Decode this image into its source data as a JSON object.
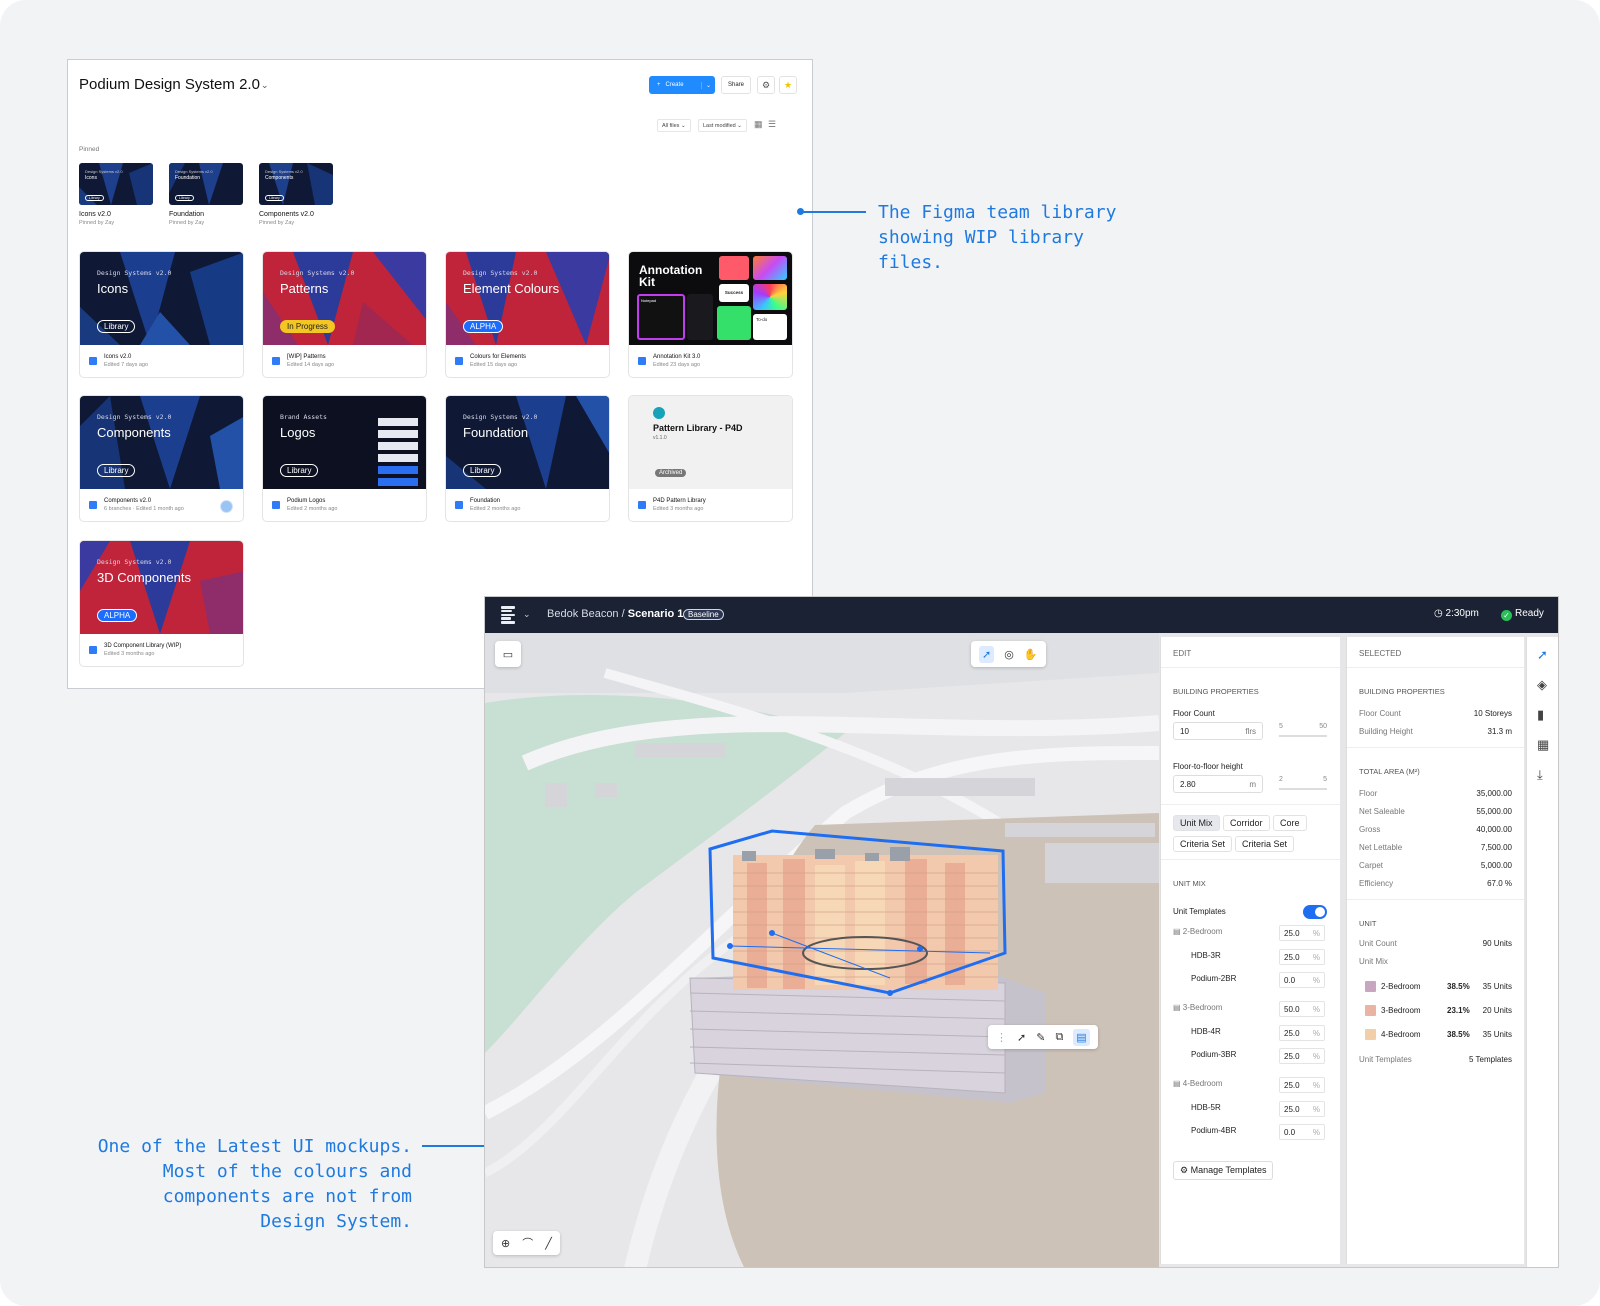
{
  "annotations": {
    "figma_note": [
      "The Figma team library",
      "showing WIP library",
      "files."
    ],
    "ui_note": [
      "One of the Latest UI mockups.",
      "Most of the colours and",
      "components are not from",
      "Design System."
    ]
  },
  "figma": {
    "title": "Podium Design System 2.0",
    "create_label": "Create",
    "share_label": "Share",
    "filter_files": "All files",
    "filter_sort": "Last modified",
    "pinned_label": "Pinned",
    "pinned": [
      {
        "thumb_kicker": "Design Systems v2.0",
        "thumb_title": "Icons",
        "tag": "Library",
        "name": "Icons v2.0",
        "sub": "Pinned by Zay"
      },
      {
        "thumb_kicker": "Design Systems v2.0",
        "thumb_title": "Foundation",
        "tag": "Library",
        "name": "Foundation",
        "sub": "Pinned by Zay"
      },
      {
        "thumb_kicker": "Design Systems v2.0",
        "thumb_title": "Components",
        "tag": "Library",
        "name": "Components v2.0",
        "sub": "Pinned by Zay"
      }
    ],
    "cards": [
      {
        "kicker": "Design Systems v2.0",
        "title": "Icons",
        "tag": "Library",
        "file": "Icons v2.0",
        "meta": "Edited 7 days ago"
      },
      {
        "kicker": "Design Systems v2.0",
        "title": "Patterns",
        "tag": "In Progress",
        "file": "[WIP] Patterns",
        "meta": "Edited 14 days ago"
      },
      {
        "kicker": "Design Systems v2.0",
        "title": "Element Colours",
        "tag": "ALPHA",
        "file": "Colours for Elements",
        "meta": "Edited 15 days ago"
      },
      {
        "title": "Annotation Kit",
        "file": "Annotation Kit 3.0",
        "meta": "Edited 23 days ago",
        "inner_labels": [
          "Notepad",
          "Success",
          "To-do"
        ]
      },
      {
        "kicker": "Design Systems v2.0",
        "title": "Components",
        "tag": "Library",
        "file": "Components v2.0",
        "meta": "6 branches · Edited 1 month ago"
      },
      {
        "kicker": "Brand Assets",
        "title": "Logos",
        "tag": "Library",
        "file": "Podium Logos",
        "meta": "Edited 2 months ago"
      },
      {
        "kicker": "Design Systems v2.0",
        "title": "Foundation",
        "tag": "Library",
        "file": "Foundation",
        "meta": "Edited 2 months ago"
      },
      {
        "title": "Pattern Library - P4D",
        "version": "v1.1.0",
        "tag": "Archived",
        "file": "P4D Pattern Library",
        "meta": "Edited 3 months ago"
      },
      {
        "kicker": "Design Systems v2.0",
        "title": "3D Components",
        "tag": "ALPHA",
        "file": "3D Component Library (WIP)",
        "meta": "Edited 3 months ago"
      }
    ]
  },
  "app": {
    "project": "Bedok Beacon",
    "separator": "/",
    "scenario": "Scenario 1",
    "badge": "Baseline",
    "time": "2:30pm",
    "status": "Ready",
    "edit": {
      "header": "EDIT",
      "section_building": "BUILDING PROPERTIES",
      "floor_count_label": "Floor Count",
      "floor_count_value": "10",
      "floor_count_unit": "flrs",
      "floor_min": "5",
      "floor_max": "50",
      "f2f_label": "Floor-to-floor height",
      "f2f_value": "2.80",
      "f2f_unit": "m",
      "f2f_min": "2",
      "f2f_max": "5",
      "chips": [
        "Unit Mix",
        "Corridor",
        "Core",
        "Criteria Set",
        "Criteria Set"
      ],
      "section_unitmix": "UNIT MIX",
      "unit_templates_label": "Unit Templates",
      "pct_unit": "%",
      "groups": [
        {
          "name": "2-Bedroom",
          "value": "25.0",
          "rows": [
            {
              "name": "HDB-3R",
              "value": "25.0"
            },
            {
              "name": "Podium-2BR",
              "value": "0.0"
            }
          ]
        },
        {
          "name": "3-Bedroom",
          "value": "50.0",
          "rows": [
            {
              "name": "HDB-4R",
              "value": "25.0"
            },
            {
              "name": "Podium-3BR",
              "value": "25.0"
            }
          ]
        },
        {
          "name": "4-Bedroom",
          "value": "25.0",
          "rows": [
            {
              "name": "HDB-5R",
              "value": "25.0"
            },
            {
              "name": "Podium-4BR",
              "value": "0.0"
            }
          ]
        }
      ],
      "manage_label": "Manage Templates"
    },
    "selected": {
      "header": "SELECTED",
      "section_building": "BUILDING PROPERTIES",
      "building": [
        {
          "label": "Floor Count",
          "value": "10 Storeys"
        },
        {
          "label": "Building Height",
          "value": "31.3 m"
        }
      ],
      "section_area": "TOTAL AREA (M²)",
      "area": [
        {
          "label": "Floor",
          "value": "35,000.00"
        },
        {
          "label": "Net Saleable",
          "value": "55,000.00"
        },
        {
          "label": "Gross",
          "value": "40,000.00"
        },
        {
          "label": "Net Lettable",
          "value": "7,500.00"
        },
        {
          "label": "Carpet",
          "value": "5,000.00"
        },
        {
          "label": "Efficiency",
          "value": "67.0 %"
        }
      ],
      "section_unit": "UNIT",
      "unit_count_label": "Unit Count",
      "unit_count_value": "90 Units",
      "unit_mix_label": "Unit Mix",
      "mix": [
        {
          "name": "2-Bedroom",
          "pct": "38.5%",
          "units": "35 Units",
          "color": "#c9a6bf"
        },
        {
          "name": "3-Bedroom",
          "pct": "23.1%",
          "units": "20 Units",
          "color": "#eab4a2"
        },
        {
          "name": "4-Bedroom",
          "pct": "38.5%",
          "units": "35 Units",
          "color": "#f2cfa8"
        }
      ],
      "templates_label": "Unit Templates",
      "templates_value": "5 Templates"
    },
    "view_mode": "3D"
  },
  "colors": {
    "accent": "#1f7ae0",
    "topbar": "#1a2233",
    "select_box": "#1f6df0"
  }
}
